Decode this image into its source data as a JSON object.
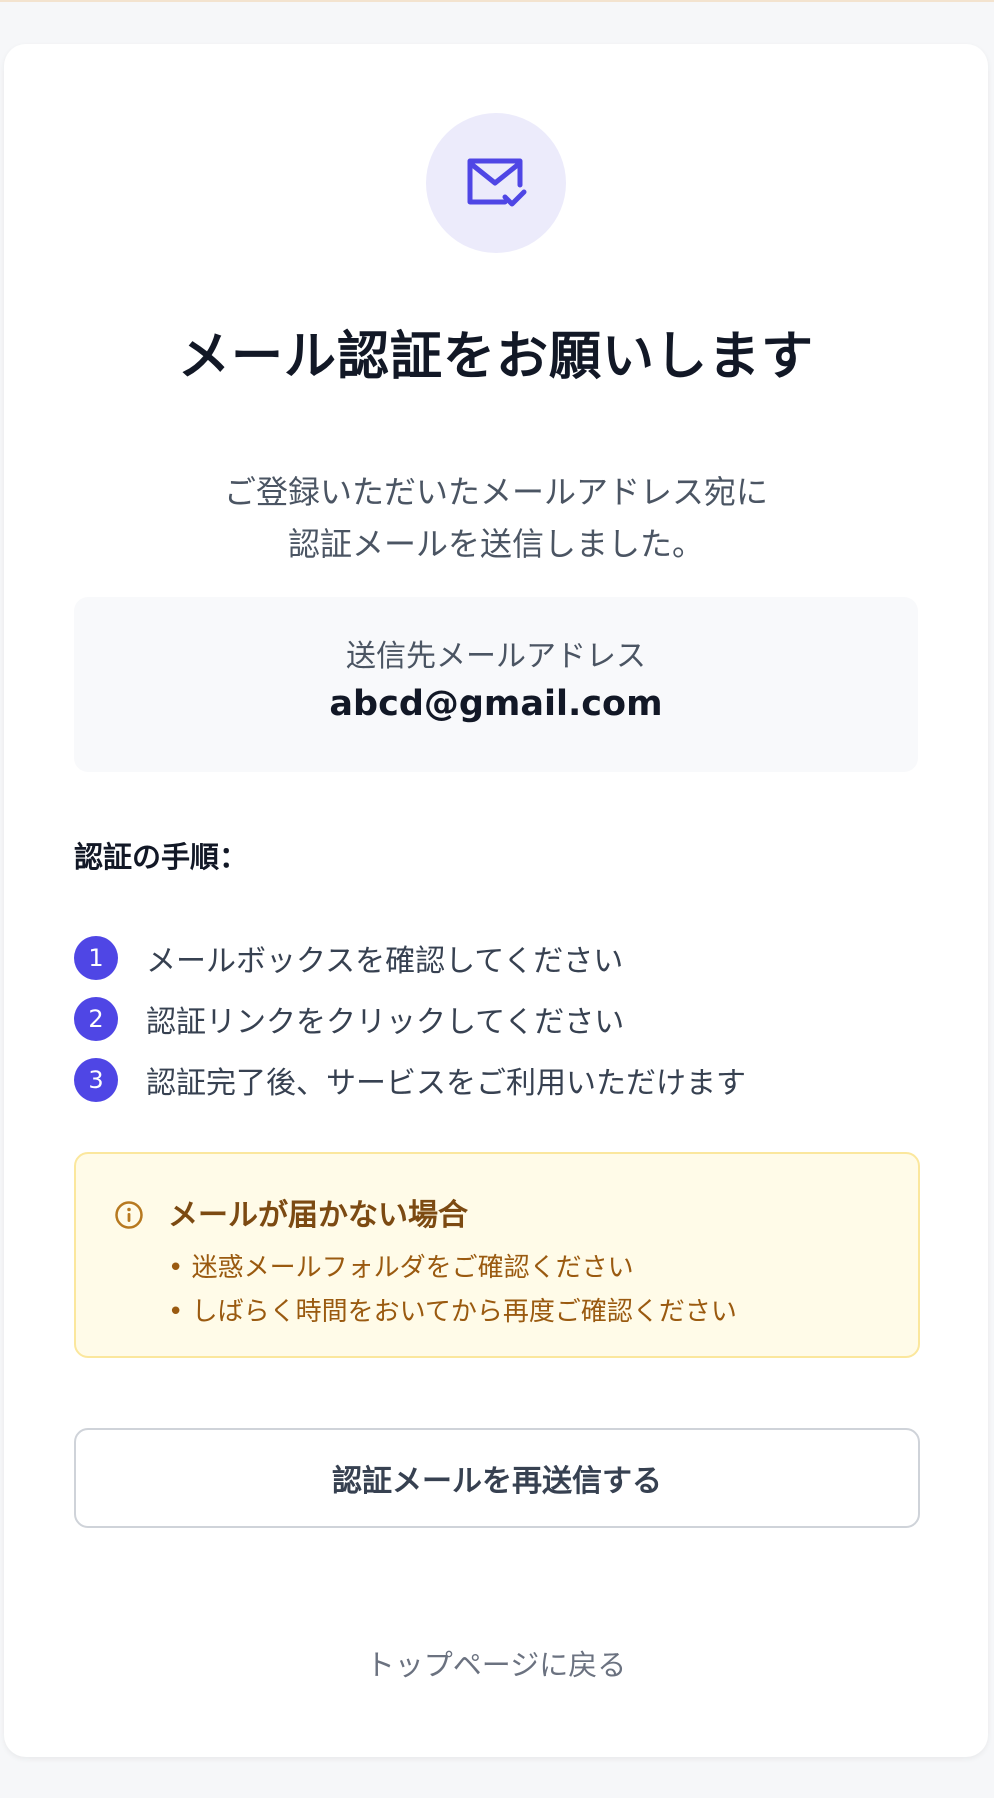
{
  "header": {
    "title": "メール認証をお願いします",
    "subtitle_line1": "ご登録いただいたメールアドレス宛に",
    "subtitle_line2": "認証メールを送信しました。"
  },
  "email": {
    "label": "送信先メールアドレス",
    "value": "abcd@gmail.com"
  },
  "steps": {
    "title": "認証の手順：",
    "items": [
      {
        "num": "1",
        "text": "メールボックスを確認してください"
      },
      {
        "num": "2",
        "text": "認証リンクをクリックしてください"
      },
      {
        "num": "3",
        "text": "認証完了後、サービスをご利用いただけます"
      }
    ]
  },
  "notice": {
    "title": "メールが届かない場合",
    "items": [
      "• 迷惑メールフォルダをご確認ください",
      "• しばらく時間をおいてから再度ご確認ください"
    ]
  },
  "actions": {
    "resend_label": "認証メールを再送信する",
    "back_label": "トップページに戻る"
  },
  "colors": {
    "accent": "#4f46e5",
    "notice_bg": "#fffbe8",
    "notice_text": "#9a5a10"
  },
  "icons": {
    "hero": "mail-check-icon",
    "notice": "info-icon"
  }
}
